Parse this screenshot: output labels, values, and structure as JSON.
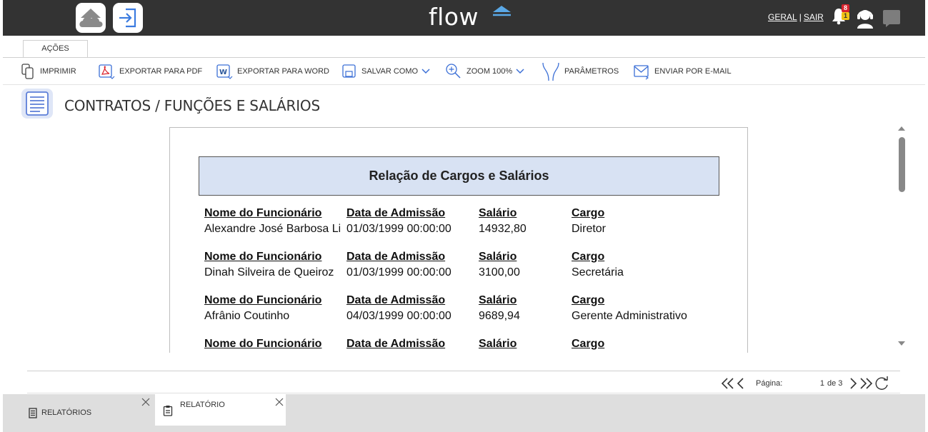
{
  "header": {
    "logo_text": "flow",
    "links": {
      "geral": "GERAL",
      "separator": "|",
      "sair": "SAIR"
    },
    "notifications": {
      "red_badge": "8",
      "yellow_badge": "1"
    },
    "icons": [
      "home-cloud-icon",
      "login-arrow-icon",
      "bell-icon",
      "support-agent-icon",
      "chat-icon"
    ]
  },
  "tabs": {
    "actions_label": "AÇÕES"
  },
  "toolbar": {
    "print": "IMPRIMIR",
    "export_pdf": "EXPORTAR PARA PDF",
    "export_word": "EXPORTAR PARA WORD",
    "save_as": "SALVAR COMO",
    "zoom": "ZOOM 100%",
    "parameters": "PARÂMETROS",
    "email": "ENVIAR POR E-MAIL"
  },
  "page": {
    "title": "CONTRATOS / FUNÇÕES E SALÁRIOS"
  },
  "report": {
    "title": "Relação de Cargos e Salários",
    "columns": {
      "name": "Nome do Funcionário",
      "admission": "Data de Admissão",
      "salary": "Salário",
      "role": "Cargo"
    },
    "records": [
      {
        "name": "Alexandre José Barbosa Lima Sobrinho",
        "admission": "01/03/1999 00:00:00",
        "salary": "14932,80",
        "role": "Diretor"
      },
      {
        "name": "Dinah Silveira de Queiroz",
        "admission": "01/03/1999 00:00:00",
        "salary": "3100,00",
        "role": "Secretária"
      },
      {
        "name": "Afrânio Coutinho",
        "admission": "04/03/1999 00:00:00",
        "salary": "9689,94",
        "role": "Gerente Administrativo"
      },
      {
        "name": "",
        "admission": "",
        "salary": "",
        "role": ""
      }
    ]
  },
  "pager": {
    "label": "Página:",
    "current": "1",
    "of_text": "de 3"
  },
  "bottom_tabs": [
    {
      "label": "RELATÓRIOS"
    },
    {
      "label": "RELATÓRIO"
    }
  ],
  "colors": {
    "topbar": "#333333",
    "report_header_bg": "#d8e2f3",
    "toolbar_icon": "#4a6fd1",
    "badge_red": "#d9232d",
    "badge_yellow": "#f2c316"
  }
}
